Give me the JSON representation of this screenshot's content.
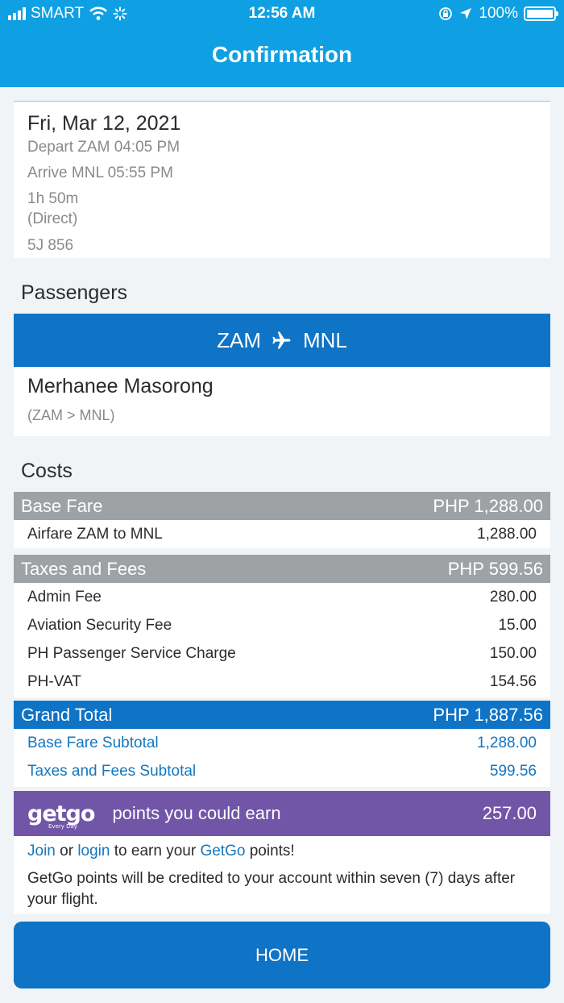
{
  "status": {
    "carrier": "SMART",
    "time": "12:56 AM",
    "battery": "100%"
  },
  "header": {
    "title": "Confirmation"
  },
  "flight": {
    "date": "Fri, Mar 12, 2021",
    "depart": "Depart  ZAM  04:05 PM",
    "arrive": "Arrive  MNL  05:55 PM",
    "duration": "1h 50m",
    "type": "(Direct)",
    "flight_no": "5J 856"
  },
  "passengers": {
    "heading": "Passengers",
    "route_from": "ZAM",
    "route_to": "MNL",
    "name": "Merhanee Masorong",
    "pax_route": "(ZAM > MNL)"
  },
  "costs": {
    "heading": "Costs",
    "base_fare": {
      "label": "Base Fare",
      "amount": "PHP 1,288.00",
      "items": [
        {
          "label": "Airfare ZAM to MNL",
          "value": "1,288.00"
        }
      ]
    },
    "taxes": {
      "label": "Taxes and Fees",
      "amount": "PHP 599.56",
      "items": [
        {
          "label": "Admin Fee",
          "value": "280.00"
        },
        {
          "label": "Aviation Security Fee",
          "value": "15.00"
        },
        {
          "label": "PH Passenger Service Charge",
          "value": "150.00"
        },
        {
          "label": "PH-VAT",
          "value": "154.56"
        }
      ]
    },
    "grand_total": {
      "label": "Grand Total",
      "amount": "PHP 1,887.56",
      "items": [
        {
          "label": "Base Fare Subtotal",
          "value": "1,288.00"
        },
        {
          "label": "Taxes and Fees Subtotal",
          "value": "599.56"
        }
      ]
    }
  },
  "getgo": {
    "logo": "getgo",
    "tagline": "Every Day",
    "points_label": "points you could earn",
    "points": "257.00",
    "join": "Join",
    "or": "or",
    "login": "login",
    "earn_prefix": "to earn your",
    "brand": "GetGo",
    "earn_suffix": "points!",
    "note": "GetGo points will be credited to your account within seven (7) days after your flight."
  },
  "home_button": "HOME",
  "colors": {
    "header": "#0fa0e3",
    "primary": "#0f73c6",
    "gray_bar": "#9ea2a4",
    "getgo": "#7156a8",
    "link": "#1477bf"
  }
}
